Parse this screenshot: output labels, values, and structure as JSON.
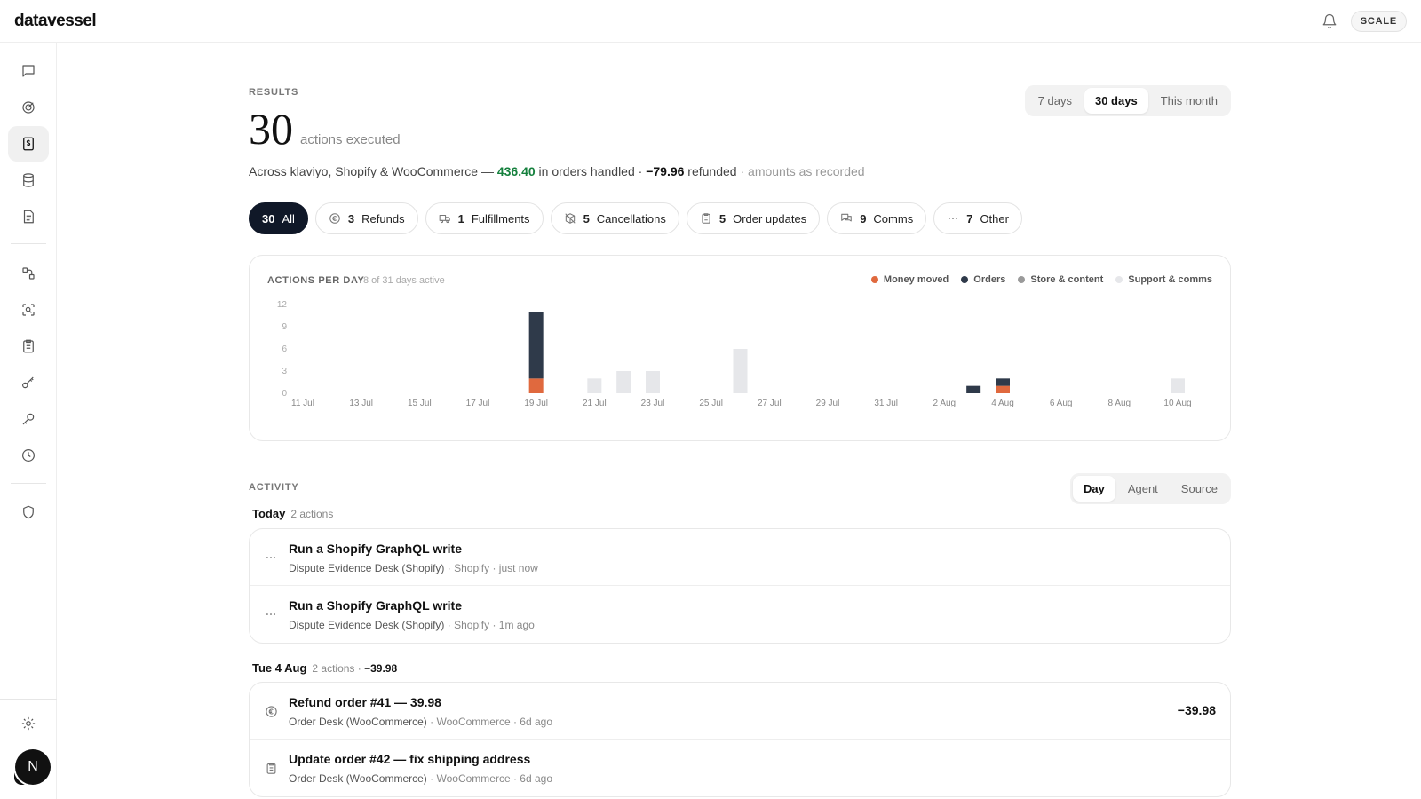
{
  "app": {
    "logo": "datavessel",
    "plan_badge": "SCALE"
  },
  "sidebar": {
    "items": [
      {
        "icon": "chat-icon"
      },
      {
        "icon": "target-icon"
      },
      {
        "icon": "billing-icon",
        "active": true
      },
      {
        "icon": "database-icon"
      },
      {
        "icon": "document-icon"
      },
      {
        "icon": "flow-icon"
      },
      {
        "icon": "scan-search-icon"
      },
      {
        "icon": "clipboard-icon"
      },
      {
        "icon": "key-link-icon"
      },
      {
        "icon": "key-icon"
      },
      {
        "icon": "clock-icon"
      },
      {
        "icon": "shield-icon"
      },
      {
        "icon": "gear-icon"
      }
    ],
    "avatar_letter": "N"
  },
  "results": {
    "label": "RESULTS",
    "count": "30",
    "count_label": "actions executed",
    "summary_prefix": "Across klaviyo, Shopify & WooCommerce — ",
    "orders_amount": "436.40",
    "orders_text": " in orders handled · ",
    "refund_amount": "−79.96",
    "refund_text": " refunded",
    "note": " · amounts as recorded"
  },
  "range": {
    "options": [
      "7 days",
      "30 days",
      "This month"
    ],
    "active": "30 days"
  },
  "filters": [
    {
      "count": "30",
      "label": "All",
      "active": true,
      "icon": ""
    },
    {
      "count": "3",
      "label": "Refunds",
      "icon": "refund-icon"
    },
    {
      "count": "1",
      "label": "Fulfillments",
      "icon": "truck-icon"
    },
    {
      "count": "5",
      "label": "Cancellations",
      "icon": "box-cancel-icon"
    },
    {
      "count": "5",
      "label": "Order updates",
      "icon": "clipboard-icon"
    },
    {
      "count": "9",
      "label": "Comms",
      "icon": "comms-icon"
    },
    {
      "count": "7",
      "label": "Other",
      "icon": "more-icon"
    }
  ],
  "chart_data": {
    "type": "bar",
    "title": "ACTIONS PER DAY",
    "subtitle": "8 of 31 days active",
    "ylim": [
      0,
      12
    ],
    "yticks": [
      0,
      3,
      6,
      9,
      12
    ],
    "x_tick_labels": [
      "11 Jul",
      "13 Jul",
      "15 Jul",
      "17 Jul",
      "19 Jul",
      "21 Jul",
      "23 Jul",
      "25 Jul",
      "27 Jul",
      "29 Jul",
      "31 Jul",
      "2 Aug",
      "4 Aug",
      "6 Aug",
      "8 Aug",
      "10 Aug"
    ],
    "categories": [
      "11 Jul",
      "12 Jul",
      "13 Jul",
      "14 Jul",
      "15 Jul",
      "16 Jul",
      "17 Jul",
      "18 Jul",
      "19 Jul",
      "20 Jul",
      "21 Jul",
      "22 Jul",
      "23 Jul",
      "24 Jul",
      "25 Jul",
      "26 Jul",
      "27 Jul",
      "28 Jul",
      "29 Jul",
      "30 Jul",
      "31 Jul",
      "1 Aug",
      "2 Aug",
      "3 Aug",
      "4 Aug",
      "5 Aug",
      "6 Aug",
      "7 Aug",
      "8 Aug",
      "9 Aug",
      "10 Aug"
    ],
    "legend_position": "top-right",
    "series": [
      {
        "name": "Money moved",
        "color": "#e0693e",
        "values": [
          0,
          0,
          0,
          0,
          0,
          0,
          0,
          0,
          2,
          0,
          0,
          0,
          0,
          0,
          0,
          0,
          0,
          0,
          0,
          0,
          0,
          0,
          0,
          0,
          1,
          0,
          0,
          0,
          0,
          0,
          0
        ]
      },
      {
        "name": "Orders",
        "color": "#2f3a4a",
        "values": [
          0,
          0,
          0,
          0,
          0,
          0,
          0,
          0,
          9,
          0,
          0,
          0,
          0,
          0,
          0,
          0,
          0,
          0,
          0,
          0,
          0,
          0,
          0,
          1,
          1,
          0,
          0,
          0,
          0,
          0,
          0
        ]
      },
      {
        "name": "Store & content",
        "color": "#9a9a9a",
        "values": [
          0,
          0,
          0,
          0,
          0,
          0,
          0,
          0,
          0,
          0,
          0,
          0,
          0,
          0,
          0,
          0,
          0,
          0,
          0,
          0,
          0,
          0,
          0,
          0,
          0,
          0,
          0,
          0,
          0,
          0,
          0
        ]
      },
      {
        "name": "Support & comms",
        "color": "#e6e7ea",
        "values": [
          0,
          0,
          0,
          0,
          0,
          0,
          0,
          0,
          0,
          0,
          2,
          3,
          3,
          0,
          0,
          6,
          0,
          0,
          0,
          0,
          0,
          0,
          0,
          0,
          0,
          0,
          0,
          0,
          0,
          0,
          2
        ]
      }
    ]
  },
  "activity": {
    "label": "ACTIVITY",
    "group_options": [
      "Day",
      "Agent",
      "Source"
    ],
    "group_active": "Day",
    "groups": [
      {
        "day": "Today",
        "meta": "2 actions",
        "value": "",
        "rows": [
          {
            "icon": "more-icon",
            "title": "Run a Shopify GraphQL write",
            "agent": "Dispute Evidence Desk (Shopify)",
            "source": "Shopify",
            "time": "just now",
            "amount": ""
          },
          {
            "icon": "more-icon",
            "title": "Run a Shopify GraphQL write",
            "agent": "Dispute Evidence Desk (Shopify)",
            "source": "Shopify",
            "time": "1m ago",
            "amount": ""
          }
        ]
      },
      {
        "day": "Tue 4 Aug",
        "meta": "2 actions · ",
        "value": "−39.98",
        "rows": [
          {
            "icon": "refund-icon",
            "title": "Refund order #41 — 39.98",
            "agent": "Order Desk (WooCommerce)",
            "source": "WooCommerce",
            "time": "6d ago",
            "amount": "−39.98"
          },
          {
            "icon": "clipboard-icon",
            "title": "Update order #42 — fix shipping address",
            "agent": "Order Desk (WooCommerce)",
            "source": "WooCommerce",
            "time": "6d ago",
            "amount": ""
          }
        ]
      }
    ]
  }
}
